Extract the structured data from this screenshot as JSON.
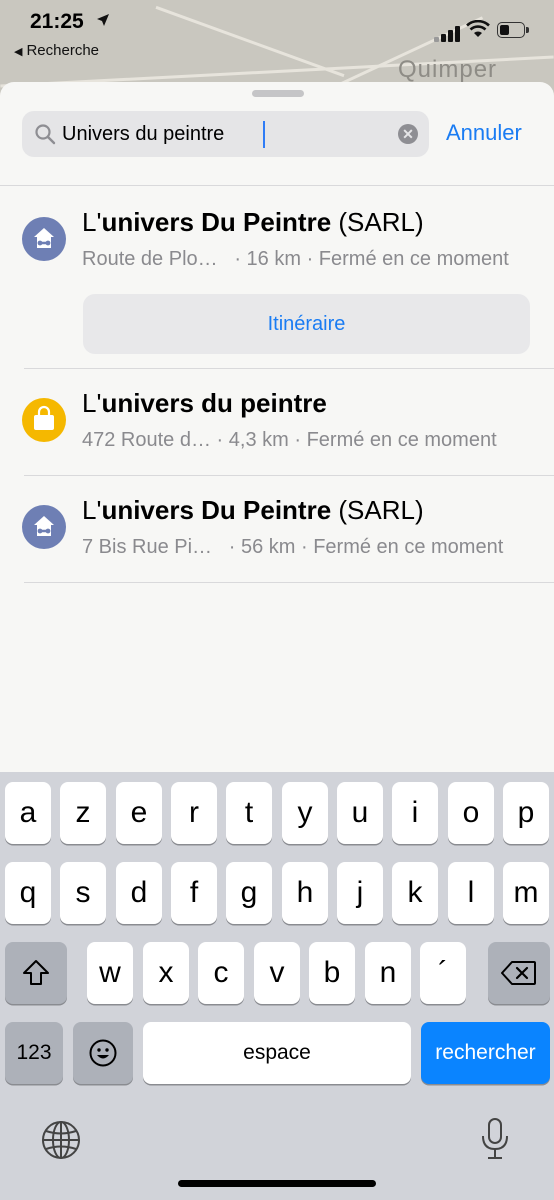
{
  "status_bar": {
    "time": "21:25",
    "back_label": "Recherche"
  },
  "map": {
    "city_label": "Quimper"
  },
  "search": {
    "value": "Univers du peintre",
    "cancel_label": "Annuler"
  },
  "results": [
    {
      "title_prefix": "L'",
      "title_bold": "univers Du Peintre",
      "title_suffix": " (SARL)",
      "address": "Route de Plo…",
      "distance": "· 16 km",
      "status": "· Fermé en ce moment",
      "icon": "house-wrench-icon",
      "icon_color": "#6e7fb4"
    },
    {
      "title_prefix": "L'",
      "title_bold": "univers du peintre",
      "title_suffix": "",
      "address": "472 Route d…",
      "distance": "· 4,3 km",
      "status": "· Fermé en ce moment",
      "icon": "shopping-bag-icon",
      "icon_color": "#f5b800"
    },
    {
      "title_prefix": "L'",
      "title_bold": "univers Du Peintre",
      "title_suffix": " (SARL)",
      "address": "7 Bis Rue Pi…",
      "distance": "· 56 km",
      "status": "· Fermé en ce moment",
      "icon": "house-wrench-icon",
      "icon_color": "#6e7fb4"
    }
  ],
  "route_button_label": "Itinéraire",
  "keyboard": {
    "row1": [
      "a",
      "z",
      "e",
      "r",
      "t",
      "y",
      "u",
      "i",
      "o",
      "p"
    ],
    "row2": [
      "q",
      "s",
      "d",
      "f",
      "g",
      "h",
      "j",
      "k",
      "l",
      "m"
    ],
    "row3": [
      "w",
      "x",
      "c",
      "v",
      "b",
      "n",
      "´"
    ],
    "numbers_label": "123",
    "space_label": "espace",
    "search_label": "rechercher"
  },
  "colors": {
    "accent": "#1a7cf3",
    "search_key": "#0a84ff"
  }
}
